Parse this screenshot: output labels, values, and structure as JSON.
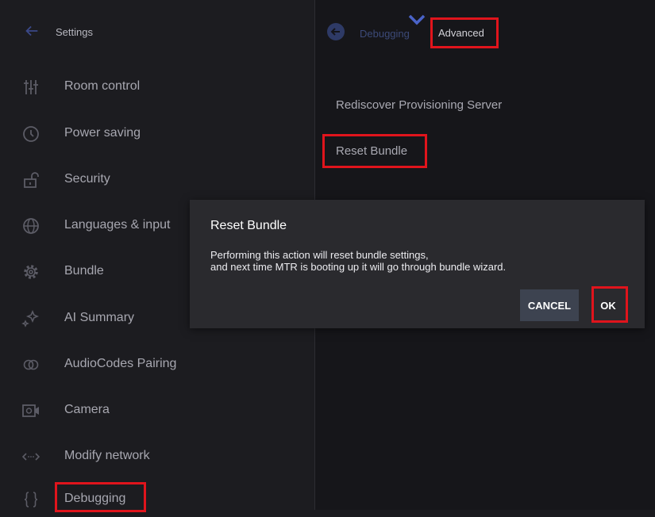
{
  "sidebar": {
    "title": "Settings",
    "items": [
      {
        "label": "Room control",
        "icon": "sliders-icon"
      },
      {
        "label": "Power saving",
        "icon": "clock-icon"
      },
      {
        "label": "Security",
        "icon": "unlock-icon"
      },
      {
        "label": "Languages & input",
        "icon": "globe-icon"
      },
      {
        "label": "Bundle",
        "icon": "gear-icon"
      },
      {
        "label": "AI Summary",
        "icon": "sparkle-icon"
      },
      {
        "label": "AudioCodes Pairing",
        "icon": "pairing-icon"
      },
      {
        "label": "Camera",
        "icon": "camera-icon"
      },
      {
        "label": "Modify network",
        "icon": "network-icon"
      },
      {
        "label": "Debugging",
        "icon": "braces-icon"
      }
    ]
  },
  "breadcrumb": {
    "previous": "Debugging",
    "current": "Advanced"
  },
  "options": {
    "rediscover": "Rediscover Provisioning Server",
    "reset_bundle": "Reset Bundle"
  },
  "dialog": {
    "title": "Reset Bundle",
    "line1": "Performing this action will reset bundle settings,",
    "line2": "and next time MTR is booting up it will go through bundle wizard.",
    "cancel_label": "CANCEL",
    "ok_label": "OK"
  },
  "colors": {
    "highlight": "#e0141c",
    "background": "#1b1b1f",
    "dialog": "#2a2a2e",
    "cancel_button": "#3d4350"
  }
}
